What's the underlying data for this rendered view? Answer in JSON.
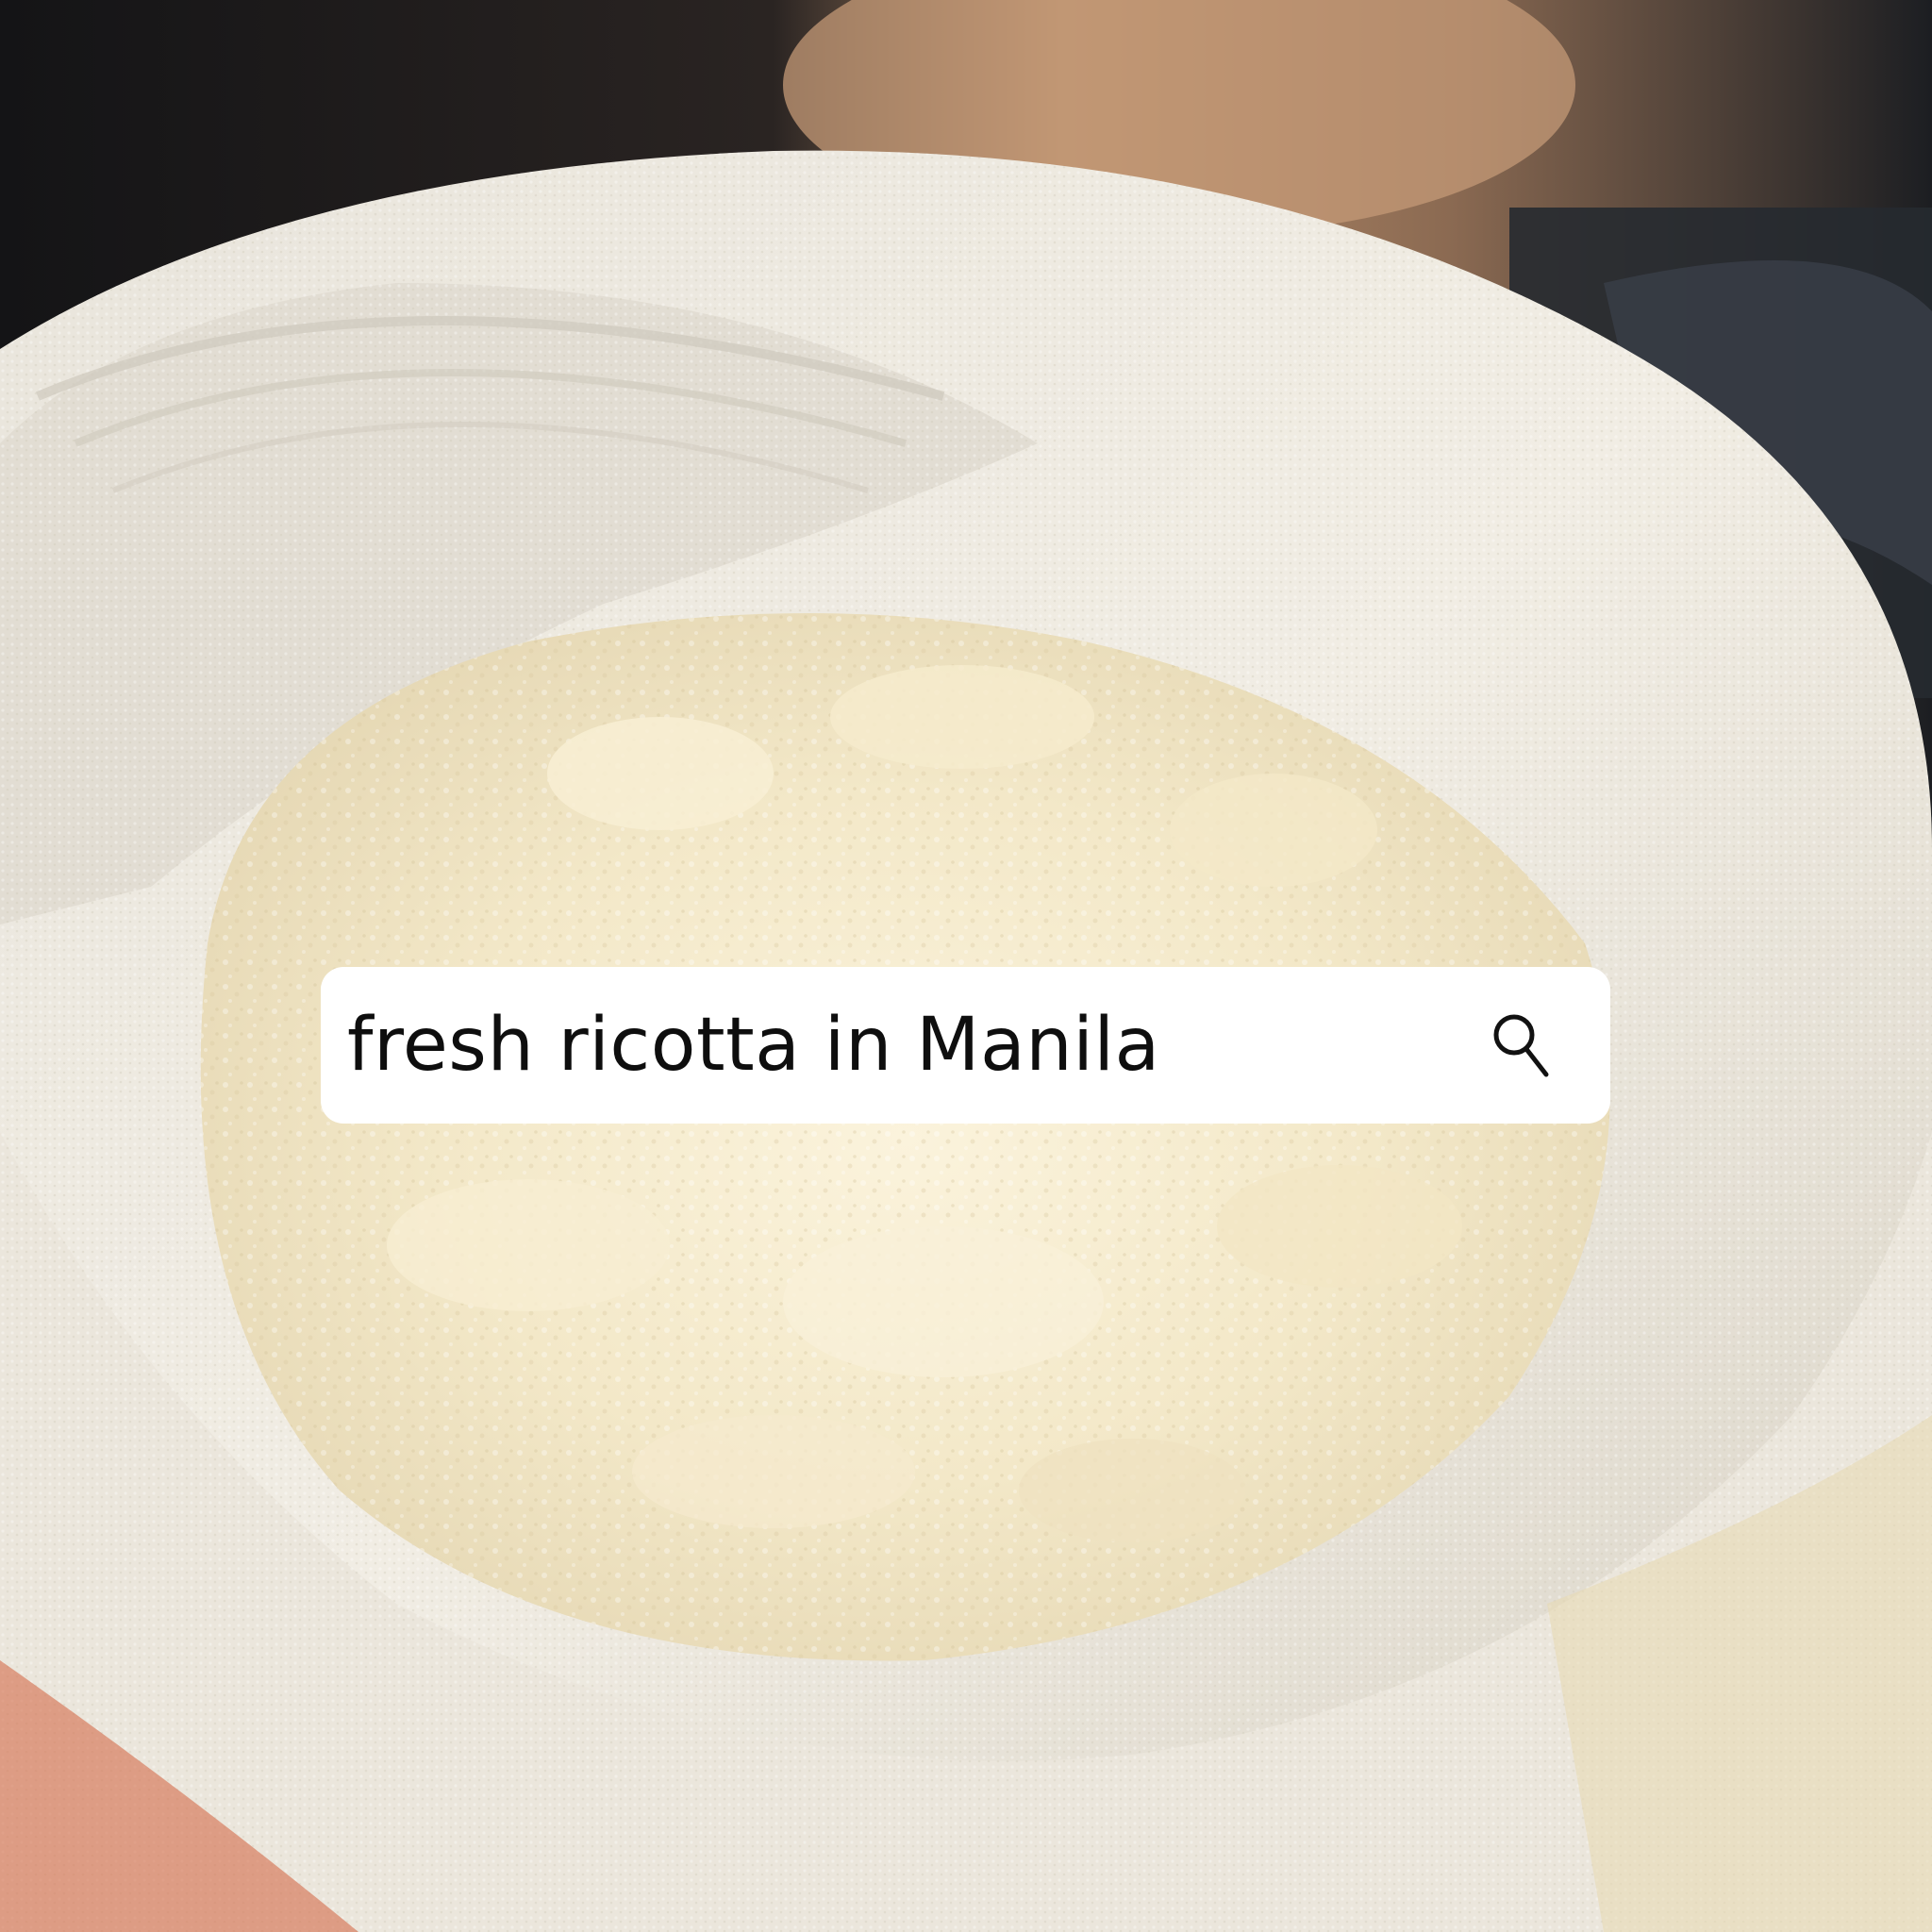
{
  "search": {
    "query": "fresh ricotta in Manila",
    "icon": "search-icon"
  },
  "colors": {
    "search_bar_bg": "#ffffff",
    "search_text": "#0e0e0e",
    "ricotta": "#f2ead2",
    "cheesecloth": "#ece7dd",
    "background": "#1d1d1f"
  }
}
